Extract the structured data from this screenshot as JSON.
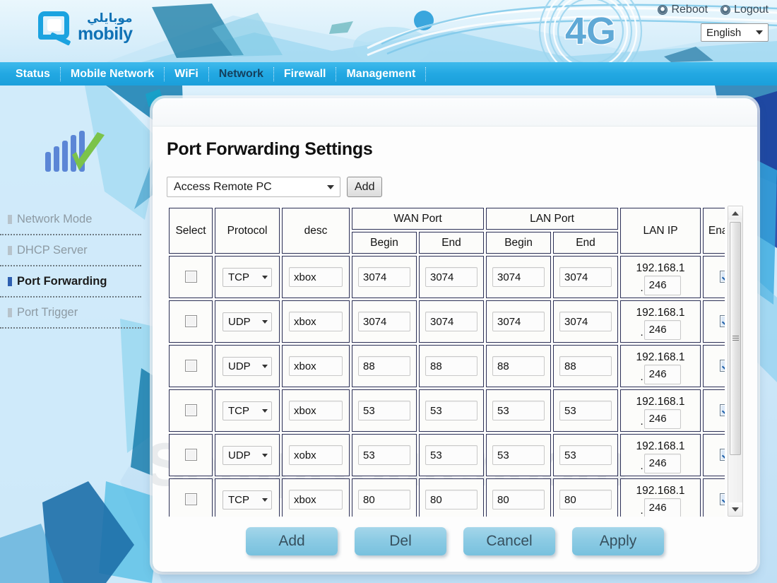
{
  "brand": {
    "logo_arabic": "موبايلي",
    "logo_latin": "mobily",
    "network_badge": "4G"
  },
  "header": {
    "reboot_label": "Reboot",
    "logout_label": "Logout",
    "language_value": "English",
    "reboot_icon": "power-icon",
    "logout_icon": "power-icon",
    "lang_caret_icon": "chevron-down-icon"
  },
  "nav": {
    "items": [
      {
        "label": "Status",
        "active": false
      },
      {
        "label": "Mobile Network",
        "active": false
      },
      {
        "label": "WiFi",
        "active": false
      },
      {
        "label": "Network",
        "active": true
      },
      {
        "label": "Firewall",
        "active": false
      },
      {
        "label": "Management",
        "active": false
      }
    ]
  },
  "sidebar": {
    "icon": "signal-bars-check-icon",
    "items": [
      {
        "label": "Network Mode",
        "active": false
      },
      {
        "label": "DHCP Server",
        "active": false
      },
      {
        "label": "Port Forwarding",
        "active": true
      },
      {
        "label": "Port Trigger",
        "active": false
      }
    ]
  },
  "panel": {
    "title": "Port Forwarding Settings",
    "watermark": "SetupRouter.com",
    "preset_select": {
      "value": "Access Remote PC",
      "caret_icon": "chevron-down-icon"
    },
    "add_button": "Add"
  },
  "table": {
    "headers": {
      "select": "Select",
      "protocol": "Protocol",
      "desc": "desc",
      "wan_port": "WAN Port",
      "lan_port": "LAN Port",
      "lan_ip": "LAN IP",
      "enable": "Enable",
      "begin": "Begin",
      "end": "End"
    },
    "lan_ip_prefix": "192.168.1",
    "rows": [
      {
        "selected": false,
        "protocol": "TCP",
        "desc": "xbox",
        "wan_begin": "3074",
        "wan_end": "3074",
        "lan_begin": "3074",
        "lan_end": "3074",
        "lan_ip_prefix": "192.168.1",
        "lan_ip_host": "246",
        "enabled": true
      },
      {
        "selected": false,
        "protocol": "UDP",
        "desc": "xbox",
        "wan_begin": "3074",
        "wan_end": "3074",
        "lan_begin": "3074",
        "lan_end": "3074",
        "lan_ip_prefix": "192.168.1",
        "lan_ip_host": "246",
        "enabled": true
      },
      {
        "selected": false,
        "protocol": "UDP",
        "desc": "xbox",
        "wan_begin": "88",
        "wan_end": "88",
        "lan_begin": "88",
        "lan_end": "88",
        "lan_ip_prefix": "192.168.1",
        "lan_ip_host": "246",
        "enabled": true
      },
      {
        "selected": false,
        "protocol": "TCP",
        "desc": "xbox",
        "wan_begin": "53",
        "wan_end": "53",
        "lan_begin": "53",
        "lan_end": "53",
        "lan_ip_prefix": "192.168.1",
        "lan_ip_host": "246",
        "enabled": true
      },
      {
        "selected": false,
        "protocol": "UDP",
        "desc": "xobx",
        "wan_begin": "53",
        "wan_end": "53",
        "lan_begin": "53",
        "lan_end": "53",
        "lan_ip_prefix": "192.168.1",
        "lan_ip_host": "246",
        "enabled": true
      },
      {
        "selected": false,
        "protocol": "TCP",
        "desc": "xbox",
        "wan_begin": "80",
        "wan_end": "80",
        "lan_begin": "80",
        "lan_end": "80",
        "lan_ip_prefix": "192.168.1",
        "lan_ip_host": "246",
        "enabled": true
      }
    ]
  },
  "scrollbar": {
    "up_icon": "chevron-up-icon",
    "down_icon": "chevron-down-icon"
  },
  "footer": {
    "buttons": [
      {
        "label": "Add"
      },
      {
        "label": "Del"
      },
      {
        "label": "Cancel"
      },
      {
        "label": "Apply"
      }
    ]
  },
  "colors": {
    "nav_blue": "#22a8e2",
    "brand_blue": "#1072b5",
    "active_nav": "#14405e",
    "button_blue": "#8ccbe4"
  }
}
